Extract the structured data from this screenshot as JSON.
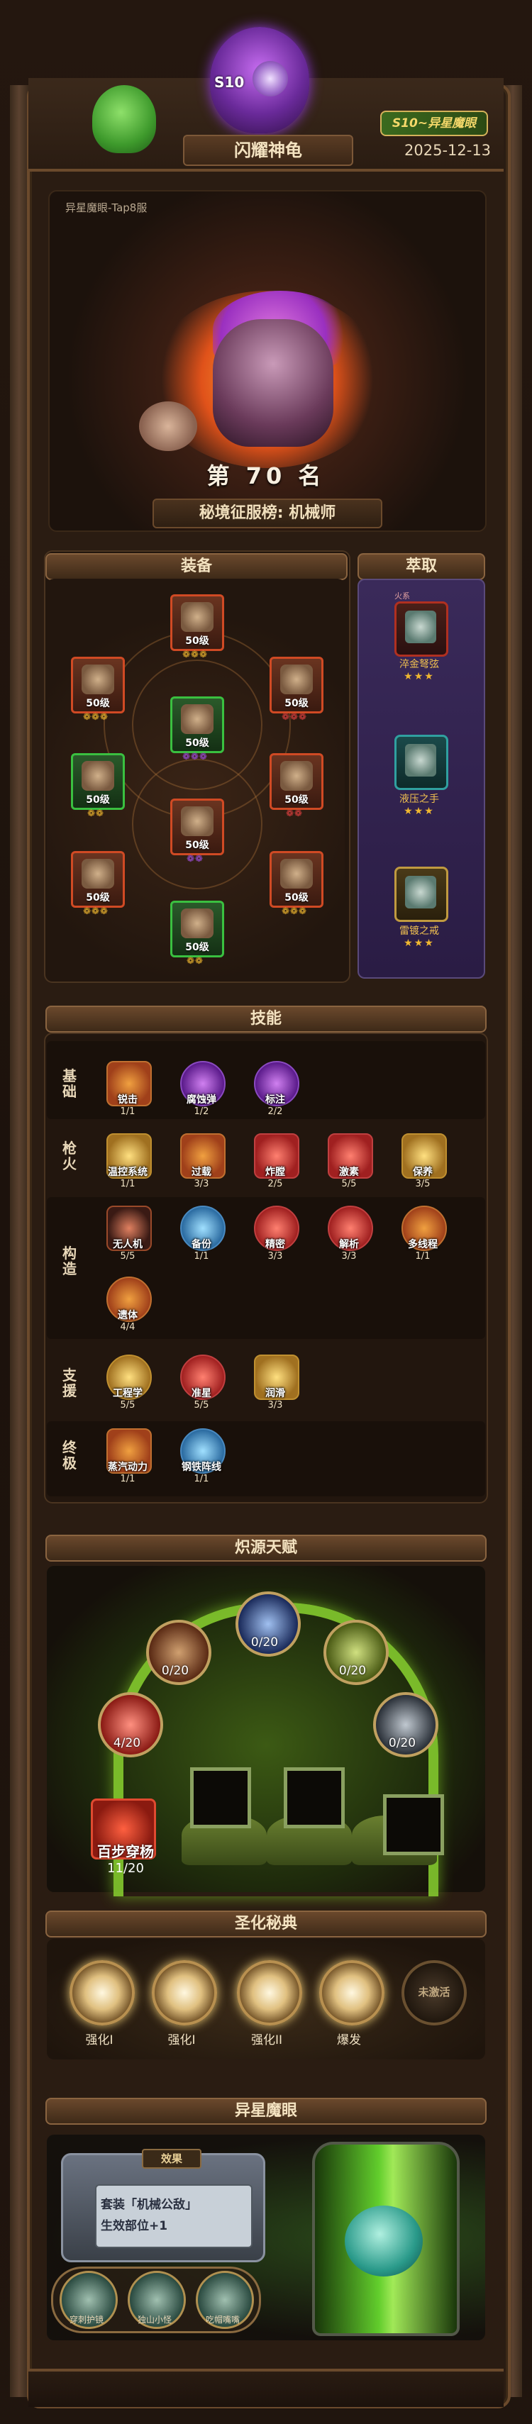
{
  "header": {
    "season_badge": "S10~异星魔眼",
    "boss_label": "S10",
    "title": "闪耀神龟",
    "date": "2025-12-13"
  },
  "hero": {
    "server": "异星魔眼-Tap8服",
    "rank": "第 70 名",
    "rank_subtitle": "秘境征服榜: 机械师"
  },
  "equipment": {
    "title": "装备",
    "slots": [
      {
        "level": "50级",
        "gems": "❁❁❁",
        "gem_color": "#f0b830"
      },
      {
        "level": "50级",
        "gems": "❁❁❁",
        "gem_color": "#f0b830"
      },
      {
        "level": "50级",
        "gems": "❁❁❁",
        "gem_color": "#e04040"
      },
      {
        "level": "50级",
        "gems": "❁❁❁",
        "gem_color": "#a050e0"
      },
      {
        "level": "50级",
        "gems": "❁❁",
        "gem_color": "#f0b830"
      },
      {
        "level": "50级",
        "gems": "❁❁",
        "gem_color": "#e04040"
      },
      {
        "level": "50级",
        "gems": "❁❁",
        "gem_color": "#a050e0"
      },
      {
        "level": "50级",
        "gems": "❁❁❁",
        "gem_color": "#f0b830"
      },
      {
        "level": "50级",
        "gems": "❁❁❁",
        "gem_color": "#f0b830"
      },
      {
        "level": "50级",
        "gems": "❁❁",
        "gem_color": "#f0b830"
      }
    ]
  },
  "extract": {
    "title": "萃取",
    "items": [
      {
        "tag": "火系",
        "name": "淬金弩弦",
        "stars": "★★★"
      },
      {
        "tag": "",
        "name": "液压之手",
        "stars": "★★★"
      },
      {
        "tag": "",
        "name": "雷镀之戒",
        "stars": "★★★"
      }
    ]
  },
  "skills": {
    "title": "技能",
    "rows": [
      {
        "label": "基础",
        "items": [
          {
            "name": "锐击",
            "level": "1/1"
          },
          {
            "name": "腐蚀弹",
            "level": "1/2"
          },
          {
            "name": "标注",
            "level": "2/2"
          }
        ]
      },
      {
        "label": "枪火",
        "items": [
          {
            "name": "温控系统",
            "level": "1/1"
          },
          {
            "name": "过载",
            "level": "3/3"
          },
          {
            "name": "炸膛",
            "level": "2/5"
          },
          {
            "name": "激素",
            "level": "5/5"
          },
          {
            "name": "保养",
            "level": "3/5"
          }
        ]
      },
      {
        "label": "构造",
        "items": [
          {
            "name": "无人机",
            "level": "5/5"
          },
          {
            "name": "备份",
            "level": "1/1"
          },
          {
            "name": "精密",
            "level": "3/3"
          },
          {
            "name": "解析",
            "level": "3/3"
          },
          {
            "name": "多线程",
            "level": "1/1"
          },
          {
            "name": "遗体",
            "level": "4/4"
          }
        ]
      },
      {
        "label": "支援",
        "items": [
          {
            "name": "工程学",
            "level": "5/5"
          },
          {
            "name": "准星",
            "level": "5/5"
          },
          {
            "name": "润滑",
            "level": "3/3"
          }
        ]
      },
      {
        "label": "终极",
        "items": [
          {
            "name": "蒸汽动力",
            "level": "1/1"
          },
          {
            "name": "钢铁阵线",
            "level": "1/1"
          }
        ]
      }
    ]
  },
  "talent": {
    "title": "炽源天赋",
    "nodes": [
      {
        "value": "0/20"
      },
      {
        "value": "0/20"
      },
      {
        "value": "0/20"
      },
      {
        "value": "4/20"
      },
      {
        "value": "0/20"
      }
    ],
    "feature": {
      "name": "百步穿杨",
      "value": "11/20"
    }
  },
  "sanctify": {
    "title": "圣化秘典",
    "orbs": [
      {
        "label": "强化I"
      },
      {
        "label": "强化I"
      },
      {
        "label": "强化II"
      },
      {
        "label": "爆发"
      }
    ],
    "inactive_label": "未激活"
  },
  "alien": {
    "title": "异星魔眼",
    "monitor_tab": "效果",
    "effect_line1": "套装「机械公敌」",
    "effect_line2": "生效部位+1",
    "pets": [
      {
        "name": "穿刺护镜"
      },
      {
        "name": "独山小怪"
      },
      {
        "name": "吃帽嘴嘴"
      }
    ]
  }
}
